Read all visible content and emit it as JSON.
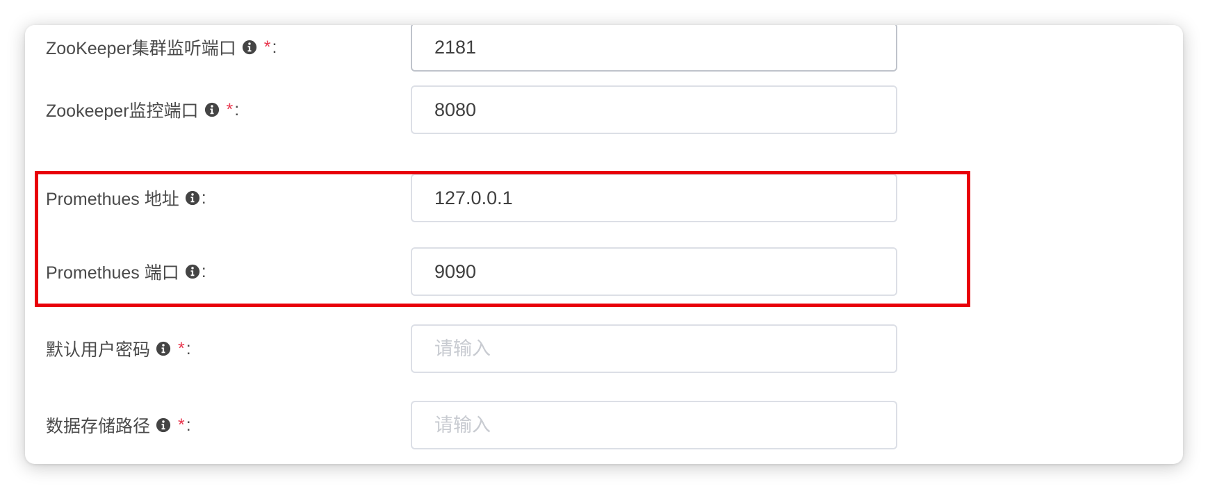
{
  "form": {
    "fields": [
      {
        "label": "ZooKeeper集群监听端口",
        "required": "*",
        "colon": ":",
        "value": "2181",
        "placeholder": ""
      },
      {
        "label": "Zookeeper监控端口",
        "required": "*",
        "colon": ":",
        "value": "8080",
        "placeholder": ""
      },
      {
        "label": "Promethues 地址",
        "required": "",
        "colon": ":",
        "value": "127.0.0.1",
        "placeholder": ""
      },
      {
        "label": "Promethues 端口",
        "required": "",
        "colon": ":",
        "value": "9090",
        "placeholder": ""
      },
      {
        "label": "默认用户密码",
        "required": "*",
        "colon": ":",
        "value": "",
        "placeholder": "请输入"
      },
      {
        "label": "数据存储路径",
        "required": "*",
        "colon": ":",
        "value": "",
        "placeholder": "请输入"
      }
    ]
  },
  "icons": {
    "field_info": "info-circle-icon"
  },
  "colors": {
    "required_mark": "#e8384f",
    "highlight_border": "#e8000a",
    "input_border": "#dcdfe6",
    "placeholder_text": "#c8cbd1",
    "label_text": "#4a4a4a"
  }
}
